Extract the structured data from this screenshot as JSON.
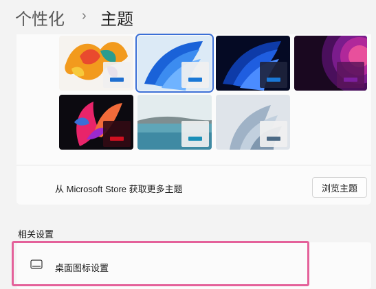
{
  "header": {
    "breadcrumb_parent": "个性化",
    "breadcrumb_separator": "›",
    "breadcrumb_current": "主题"
  },
  "themes": [
    {
      "name": "theme-colorful-splash",
      "accent": "#1f6fd0"
    },
    {
      "name": "theme-windows-light-bloom",
      "accent": "#1a78d6",
      "selected": true
    },
    {
      "name": "theme-windows-dark-bloom",
      "accent": "#1a78d6"
    },
    {
      "name": "theme-glow",
      "accent": "#7d1fa0"
    },
    {
      "name": "theme-captured-motion",
      "accent": "#d01020"
    },
    {
      "name": "theme-sunrise-lake",
      "accent": "#1a8fb8"
    },
    {
      "name": "theme-flow",
      "accent": "#4c6a85"
    }
  ],
  "store": {
    "text": "从 Microsoft Store 获取更多主题",
    "browse_label": "浏览主题"
  },
  "related": {
    "title": "相关设置",
    "desktop_icons_label": "桌面图标设置"
  },
  "colors": {
    "highlight": "#e4619a",
    "selection": "#3b6fd6"
  }
}
